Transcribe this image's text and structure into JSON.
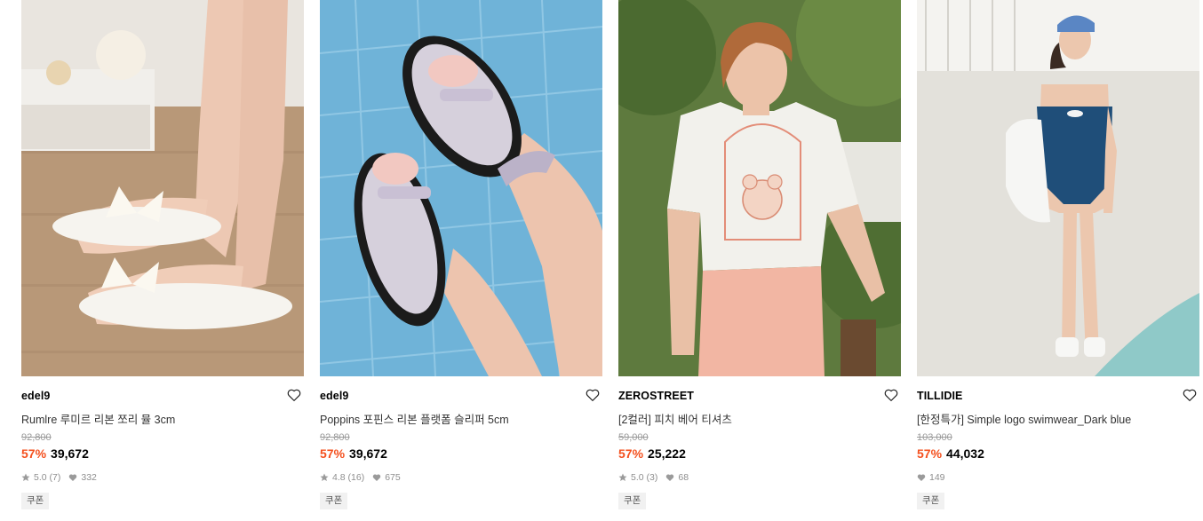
{
  "products": [
    {
      "brand": "edel9",
      "title": "Rumlre 루미르 리본 쪼리 뮬 3cm",
      "original_price": "92,800",
      "discount": "57%",
      "price": "39,672",
      "rating": "5.0",
      "review_count": "(7)",
      "likes": "332",
      "badge": "쿠폰",
      "image": "white-bow-flip-flop-sandals"
    },
    {
      "brand": "edel9",
      "title": "Poppins 포핀스 리본 플랫폼 슬리퍼 5cm",
      "original_price": "92,800",
      "discount": "57%",
      "price": "39,672",
      "rating": "4.8",
      "review_count": "(16)",
      "likes": "675",
      "badge": "쿠폰",
      "image": "silver-platform-sandals-by-pool"
    },
    {
      "brand": "ZEROSTREET",
      "title": "[2컬러] 피치 베어 티셔츠",
      "original_price": "59,000",
      "discount": "57%",
      "price": "25,222",
      "rating": "5.0",
      "review_count": "(3)",
      "likes": "68",
      "badge": "쿠폰",
      "image": "woman-in-peach-bear-tshirt"
    },
    {
      "brand": "TILLIDIE",
      "title": "[한정특가] Simple logo swimwear_Dark blue",
      "original_price": "103,000",
      "discount": "57%",
      "price": "44,032",
      "likes": "149",
      "badge": "쿠폰",
      "image": "woman-in-navy-swimsuit"
    }
  ],
  "colors": {
    "discount": "#f4501e",
    "meta": "#8e8e8e",
    "strike": "#9a9a9a"
  },
  "icons": {
    "wishlist": "heart-outline-icon",
    "rating": "star-icon",
    "likes": "heart-filled-icon"
  }
}
